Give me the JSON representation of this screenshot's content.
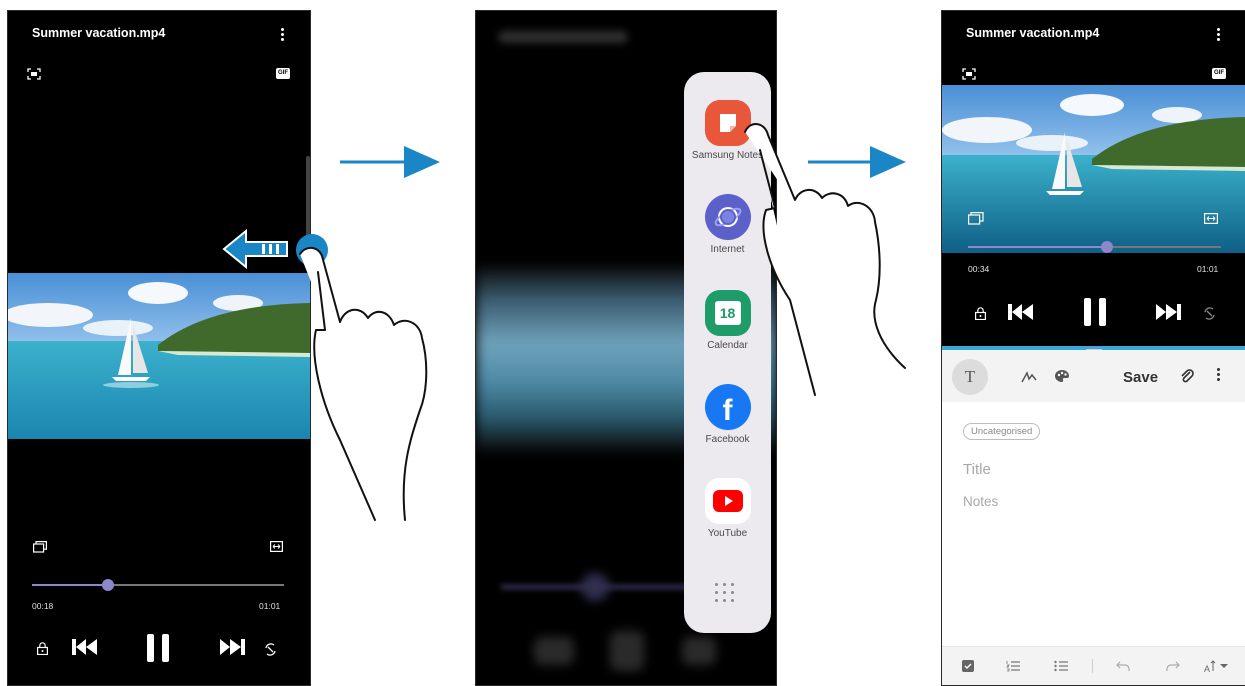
{
  "video_player": {
    "file_title": "Summer vacation.mp4",
    "gif_label": "GIF",
    "current_time": "00:18",
    "total_time": "01:01",
    "progress": 0.3
  },
  "edge_panel": {
    "apps": [
      {
        "label": "Samsung Notes",
        "icon": "samsung-notes-icon",
        "color": "#e8573a"
      },
      {
        "label": "Internet",
        "icon": "internet-icon",
        "color": "#5b61c9"
      },
      {
        "label": "Calendar",
        "icon": "calendar-icon",
        "color": "#1e9c6a",
        "date": "18"
      },
      {
        "label": "Facebook",
        "icon": "facebook-icon",
        "color": "#1877f2"
      },
      {
        "label": "YouTube",
        "icon": "youtube-icon",
        "color": "#ff0000"
      }
    ]
  },
  "split_view": {
    "video": {
      "file_title": "Summer vacation.mp4",
      "gif_label": "GIF",
      "current_time": "00:34",
      "total_time": "01:01",
      "progress": 0.55
    },
    "notes": {
      "text_tool_label": "T",
      "save_label": "Save",
      "category_chip": "Uncategorised",
      "title_placeholder": "Title",
      "body_placeholder": "Notes"
    }
  },
  "colors": {
    "arrow": "#1b86c6",
    "progress": "#8c88c9",
    "divider": "#3aa8d8"
  }
}
